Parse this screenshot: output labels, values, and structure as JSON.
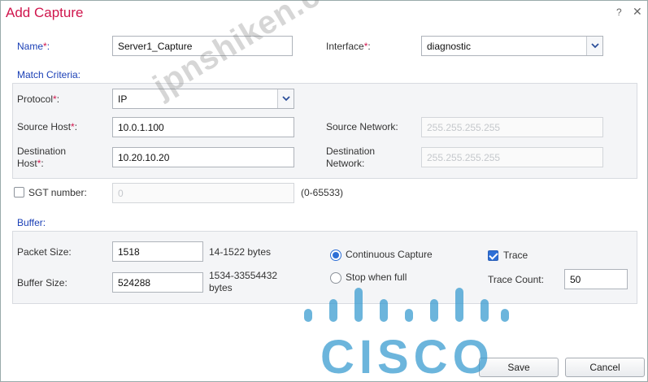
{
  "dialog": {
    "title": "Add Capture",
    "help_label": "?",
    "close_label": "✕"
  },
  "name": {
    "label": "Name",
    "required_mark": "*",
    "colon": ":",
    "value": "Server1_Capture"
  },
  "interface": {
    "label": "Interface",
    "required_mark": "*",
    "colon": ":",
    "value": "diagnostic"
  },
  "match_criteria": {
    "title": "Match Criteria:",
    "protocol": {
      "label": "Protocol",
      "required_mark": "*",
      "colon": ":",
      "value": "IP"
    },
    "source_host": {
      "label": "Source Host",
      "required_mark": "*",
      "colon": ":",
      "value": "10.0.1.100"
    },
    "source_network": {
      "label": "Source Network:",
      "placeholder": "255.255.255.255"
    },
    "destination_host": {
      "label_line1": "Destination",
      "label_line2": "Host",
      "required_mark": "*",
      "colon": ":",
      "value": "10.20.10.20"
    },
    "destination_network": {
      "label_line1": "Destination",
      "label_line2": "Network:",
      "placeholder": "255.255.255.255"
    }
  },
  "sgt": {
    "label": "SGT number:",
    "placeholder": "0",
    "range": "(0-65533)",
    "checked": false
  },
  "buffer": {
    "title": "Buffer:",
    "packet_size": {
      "label": "Packet Size:",
      "value": "1518",
      "range": "14-1522 bytes"
    },
    "buffer_size": {
      "label": "Buffer Size:",
      "value": "524288",
      "range_line1": "1534-33554432",
      "range_line2": "bytes"
    },
    "continuous_capture": {
      "label": "Continuous Capture",
      "selected": true
    },
    "stop_when_full": {
      "label": "Stop when full",
      "selected": false
    },
    "trace": {
      "label": "Trace",
      "checked": true
    },
    "trace_count": {
      "label": "Trace Count:",
      "value": "50"
    }
  },
  "footer": {
    "save_label": "Save",
    "cancel_label": "Cancel"
  },
  "overlay": {
    "watermark": "jpnshiken.com",
    "logo_word": "CISCO"
  },
  "colors": {
    "title": "#d0164d",
    "section": "#1a3fb6",
    "required": "#d0164d",
    "accent": "#2d6fd6",
    "logo": "#3399ce"
  }
}
